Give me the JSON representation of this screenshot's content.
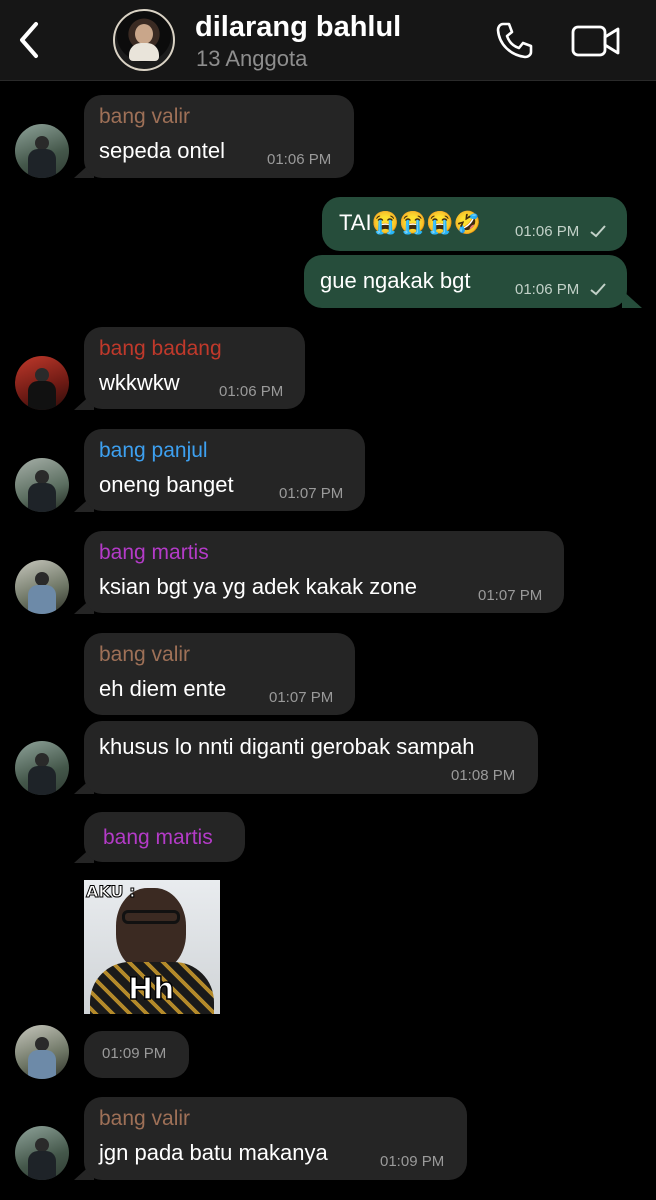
{
  "header": {
    "title": "dilarang bahlul",
    "subtitle": "13 Anggota",
    "back_icon": "chevron-left-icon",
    "call_icon": "phone-icon",
    "video_icon": "video-camera-icon"
  },
  "colors": {
    "incoming_bubble": "#252525",
    "outgoing_bubble": "#264d3b",
    "valir": "#9e7057",
    "badang": "#c0392b",
    "panjul": "#3da0f0",
    "martis": "#b43bc8"
  },
  "messages": [
    {
      "sender": "bang valir",
      "text": "sepeda ontel",
      "time": "01:06 PM"
    },
    {
      "text": "TAI😭😭😭🤣",
      "time": "01:06 PM",
      "status": "sent"
    },
    {
      "text": "gue ngakak bgt",
      "time": "01:06 PM",
      "status": "sent"
    },
    {
      "sender": "bang badang",
      "text": "wkkwkw",
      "time": "01:06 PM"
    },
    {
      "sender": "bang panjul",
      "text": "oneng banget",
      "time": "01:07 PM"
    },
    {
      "sender": "bang martis",
      "text": "ksian bgt ya yg adek kakak zone",
      "time": "01:07 PM"
    },
    {
      "sender": "bang valir",
      "text": "eh diem ente",
      "time": "01:07 PM"
    },
    {
      "text": "khusus lo nnti diganti gerobak sampah",
      "time": "01:08 PM"
    },
    {
      "sender": "bang martis"
    },
    {
      "sticker_top": "AKU :",
      "sticker_bottom": "Hh"
    },
    {
      "time": "01:09 PM"
    },
    {
      "sender": "bang valir",
      "text": "jgn pada batu makanya",
      "time": "01:09 PM"
    }
  ]
}
